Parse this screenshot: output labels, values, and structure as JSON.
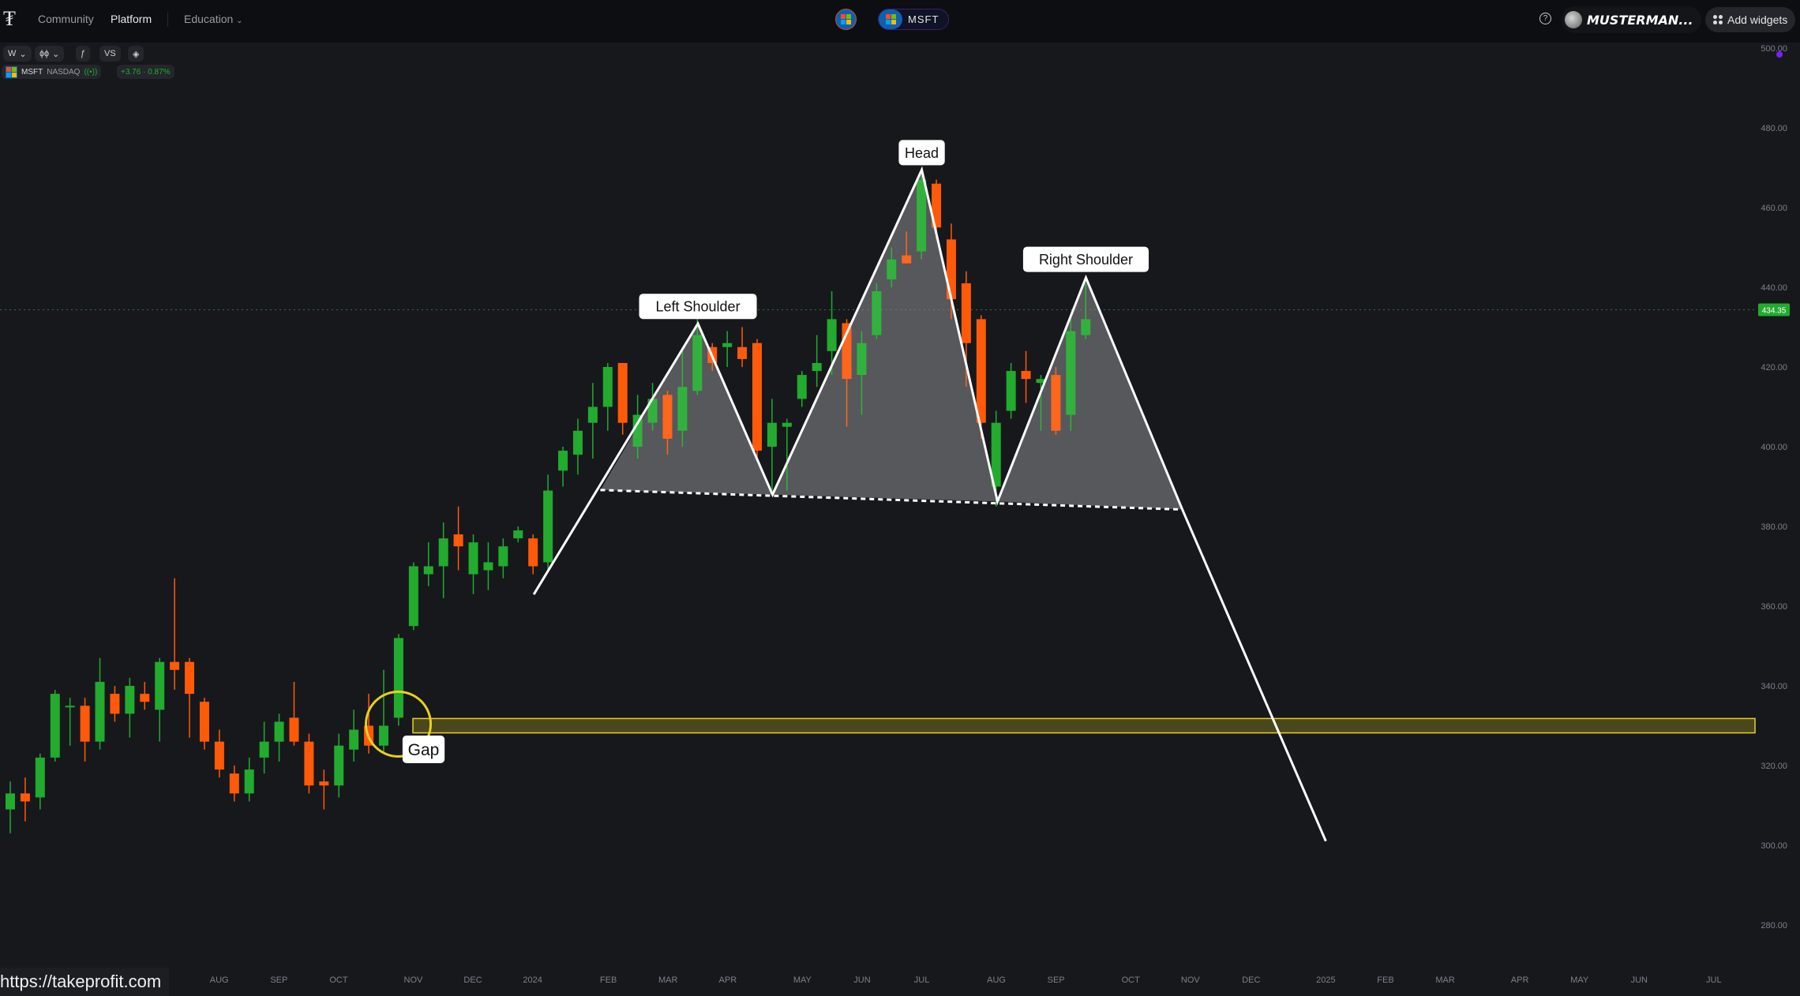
{
  "topbar": {
    "nav": [
      "Community",
      "Platform",
      "Education"
    ],
    "active_nav": "Platform",
    "education_caret": "⌄",
    "symbol_tab": "MSFT",
    "help_icon": "?",
    "username": "MUSTERMAN...",
    "add_widgets": "Add widgets"
  },
  "toolbar": {
    "interval": "W",
    "chart_type_icon": "candles-icon",
    "indicators_icon": "fx-icon",
    "compare": "VS",
    "layers_icon": "layers-icon"
  },
  "legend": {
    "symbol": "MSFT",
    "exchange": "NASDAQ",
    "change": "+3.76 · 0.87%"
  },
  "footer_url": "https://takeprofit.com",
  "colors": {
    "up": "#22ab2e",
    "down": "#ff5a0a",
    "pattern": "#ffffff",
    "gap_zone": "#e6d21e",
    "last_price": "#22ab2e"
  },
  "chart_data": {
    "type": "candlestick",
    "interval": "weekly",
    "ylim": [
      270,
      505
    ],
    "y_ticks": [
      "500.00",
      "480.00",
      "460.00",
      "440.00",
      "420.00",
      "400.00",
      "380.00",
      "360.00",
      "340.00",
      "320.00",
      "300.00",
      "280.00"
    ],
    "x_ticks": [
      "AUG",
      "SEP",
      "OCT",
      "NOV",
      "DEC",
      "2024",
      "FEB",
      "MAR",
      "APR",
      "MAY",
      "JUN",
      "JUL",
      "AUG",
      "SEP",
      "OCT",
      "NOV",
      "DEC",
      "2025",
      "FEB",
      "MAR",
      "APR",
      "MAY",
      "JUN",
      "JUL"
    ],
    "last_price": "434.35",
    "candles": [
      [
        309,
        313,
        316,
        303
      ],
      [
        313,
        311,
        317,
        306
      ],
      [
        312,
        322,
        323,
        309
      ],
      [
        322,
        338,
        339,
        321
      ],
      [
        335,
        335,
        337,
        325
      ],
      [
        335,
        326,
        337,
        321
      ],
      [
        326,
        341,
        347,
        324
      ],
      [
        338,
        333,
        340,
        331
      ],
      [
        333,
        340,
        342,
        327
      ],
      [
        338,
        336,
        341,
        334
      ],
      [
        334,
        346,
        347,
        326
      ],
      [
        346,
        344,
        367,
        339
      ],
      [
        346,
        338,
        347,
        327
      ],
      [
        336,
        326,
        337,
        324
      ],
      [
        326,
        319,
        329,
        317
      ],
      [
        318,
        313,
        320,
        311
      ],
      [
        313,
        319,
        322,
        311
      ],
      [
        322,
        326,
        331,
        318
      ],
      [
        326,
        331,
        333,
        321
      ],
      [
        332,
        326,
        341,
        325
      ],
      [
        326,
        315,
        328,
        313
      ],
      [
        316,
        315,
        319,
        309
      ],
      [
        315,
        325,
        328,
        312
      ],
      [
        324,
        329,
        334,
        321
      ],
      [
        330,
        325,
        338,
        323
      ],
      [
        325,
        330,
        344,
        323
      ],
      [
        332,
        352,
        353,
        330
      ],
      [
        355,
        370,
        371,
        354
      ],
      [
        368,
        370,
        376,
        365
      ],
      [
        370,
        377,
        381,
        362
      ],
      [
        378,
        375,
        385,
        369
      ],
      [
        368,
        376,
        378,
        363
      ],
      [
        369,
        371,
        376,
        364
      ],
      [
        370,
        375,
        377,
        367
      ],
      [
        377,
        379,
        380,
        376
      ],
      [
        377,
        370,
        378,
        368
      ],
      [
        371,
        389,
        393,
        369
      ],
      [
        394,
        399,
        400,
        390
      ],
      [
        398,
        404,
        407,
        393
      ],
      [
        406,
        410,
        416,
        397
      ],
      [
        410,
        420,
        421,
        404
      ],
      [
        421,
        406,
        421,
        403
      ],
      [
        400,
        408,
        413,
        397
      ],
      [
        406,
        412,
        416,
        404
      ],
      [
        413,
        402,
        414,
        398
      ],
      [
        404,
        415,
        424,
        400
      ],
      [
        414,
        428,
        432,
        413
      ],
      [
        425,
        421,
        426,
        419
      ],
      [
        425,
        426,
        429,
        420
      ],
      [
        425,
        422,
        430,
        420
      ],
      [
        426,
        399,
        427,
        397
      ],
      [
        400,
        406,
        412,
        389
      ],
      [
        405,
        406,
        407,
        389
      ],
      [
        412,
        418,
        419,
        410
      ],
      [
        419,
        421,
        428,
        415
      ],
      [
        424,
        432,
        439,
        418
      ],
      [
        431,
        417,
        432,
        405
      ],
      [
        418,
        426,
        429,
        408
      ],
      [
        428,
        439,
        441,
        427
      ],
      [
        442,
        447,
        450,
        440
      ],
      [
        448,
        446,
        454,
        446
      ],
      [
        449,
        467,
        468,
        447
      ],
      [
        466,
        455,
        467,
        452
      ],
      [
        452,
        437,
        456,
        432
      ],
      [
        441,
        426,
        444,
        415
      ],
      [
        432,
        406,
        433,
        402
      ],
      [
        390,
        406,
        409,
        385
      ],
      [
        409,
        419,
        421,
        407
      ],
      [
        419,
        417,
        424,
        411
      ],
      [
        416,
        417,
        418,
        404
      ],
      [
        418,
        404,
        420,
        403
      ],
      [
        408,
        429,
        432,
        404
      ],
      [
        428,
        432,
        441,
        427
      ]
    ],
    "annotations": [
      "Left Shoulder",
      "Head",
      "Right Shoulder",
      "Gap"
    ],
    "pattern": "head-and-shoulders"
  }
}
